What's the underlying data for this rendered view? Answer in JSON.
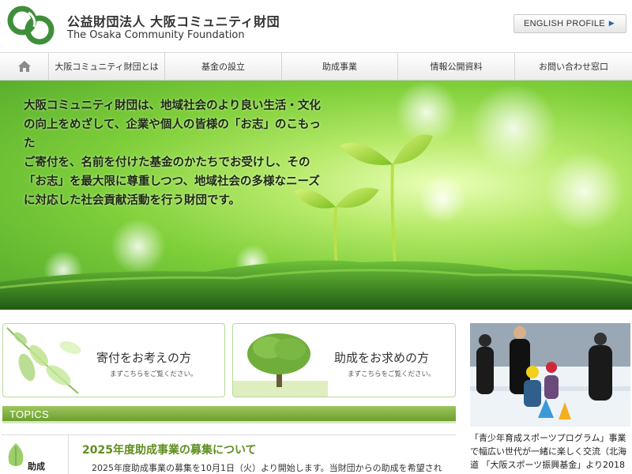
{
  "header": {
    "org_type": "公益財団法人",
    "org_name_jp": "大阪コミュニティ財団",
    "org_name_en": "The Osaka Community Foundation",
    "english_button": "ENGLISH PROFILE"
  },
  "nav": {
    "items": [
      {
        "label": "大阪コミュニティ財団とは"
      },
      {
        "label": "基金の設立"
      },
      {
        "label": "助成事業"
      },
      {
        "label": "情報公開資料"
      },
      {
        "label": "お問い合わせ窓口"
      }
    ]
  },
  "hero": {
    "lines": [
      "大阪コミュニティ財団は、地域社会のより良い生活・文化",
      "の向上をめざして、企業や個人の皆様の「お志」のこもった",
      "ご寄付を、名前を付けた基金のかたちでお受けし、その",
      "「お志」を最大限に尊重しつつ、地域社会の多様なニーズ",
      "に対応した社会貢献活動を行う財団です。"
    ]
  },
  "cards": {
    "donate": {
      "title": "寄付をお考えの方",
      "sub": "まずこちらをご覧ください。"
    },
    "grant": {
      "title": "助成をお求めの方",
      "sub": "まずこちらをご覧ください。"
    }
  },
  "topics": {
    "heading": "TOPICS",
    "items": [
      {
        "category": "助成",
        "title": "2025年度助成事業の募集について",
        "desc": "2025年度助成事業の募集を10月1日（火）より開始します。当財団からの助成を希望され"
      }
    ]
  },
  "feature": {
    "lines": [
      "「青少年育成スポーツプログラム」事業",
      "で幅広い世代が一緒に楽しく交流（北海",
      "道 「大阪スポーツ振興基金」より2018"
    ]
  },
  "colors": {
    "brand_green": "#3f8f3a",
    "topics_green": "#7aa83c",
    "topic_title_green": "#5e8f1f"
  }
}
